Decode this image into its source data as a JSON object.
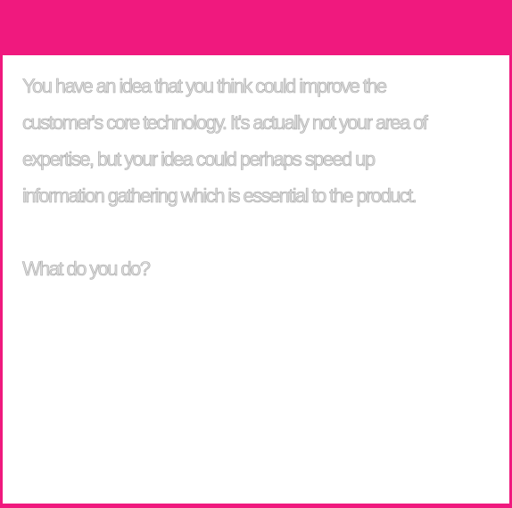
{
  "colors": {
    "accent": "#f0197e",
    "background": "#ffffff",
    "text_fill": "#dcdcdc",
    "text_outline": "#a9a9a9"
  },
  "card": {
    "paragraph": "You have an idea that you think could improve the\ncustomer's core technology.  It's actually not your area of\nexpertise, but your idea could perhaps speed up\ninformation gathering which is essential to the product.",
    "question": "What do you do?"
  }
}
